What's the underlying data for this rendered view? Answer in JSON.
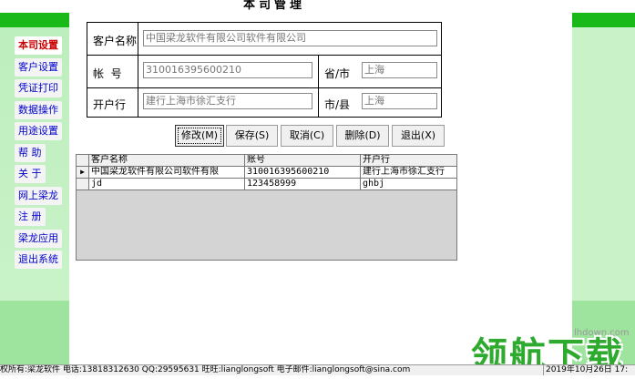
{
  "sidebar": {
    "items": [
      {
        "label": "本司设置",
        "active": true
      },
      {
        "label": "客户设置"
      },
      {
        "label": "凭证打印"
      },
      {
        "label": "数据操作"
      },
      {
        "label": "用途设置"
      },
      {
        "label": "帮 助"
      },
      {
        "label": "关 于"
      },
      {
        "label": "网上梁龙"
      },
      {
        "label": "注 册"
      },
      {
        "label": "梁龙应用"
      },
      {
        "label": "退出系统"
      }
    ]
  },
  "main": {
    "title": "本司管理",
    "form": {
      "customer_name_label": "客户名称",
      "customer_name_value": "中国梁龙软件有限公司软件有限公司",
      "account_label": "帐  号",
      "account_value": "310016395600210",
      "province_label": "省/市",
      "province_value": "上海",
      "bank_label": "开户行",
      "bank_value": "建行上海市徐汇支行",
      "city_label": "市/县",
      "city_value": "上海"
    },
    "buttons": {
      "edit": "修改(M)",
      "save": "保存(S)",
      "cancel": "取消(C)",
      "delete": "删除(D)",
      "exit": "退出(X)"
    },
    "grid": {
      "columns": [
        "客户名称",
        "账号",
        "开户行"
      ],
      "rows": [
        [
          "中国梁龙软件有限公司软件有限",
          "310016395600210",
          "建行上海市徐汇支行"
        ],
        [
          "jd",
          "123458999",
          "ghbj"
        ]
      ],
      "current_row_marker": "▶"
    }
  },
  "watermark": {
    "url": "lhdown.com",
    "text": "领航下载"
  },
  "status_bar": {
    "left": "权所有:梁龙软件 电话:13818312630 QQ:29595631 旺旺:lianglongsoft 电子邮件:lianglongsoft@sina.com",
    "right": "2019年10月26日  17:"
  }
}
